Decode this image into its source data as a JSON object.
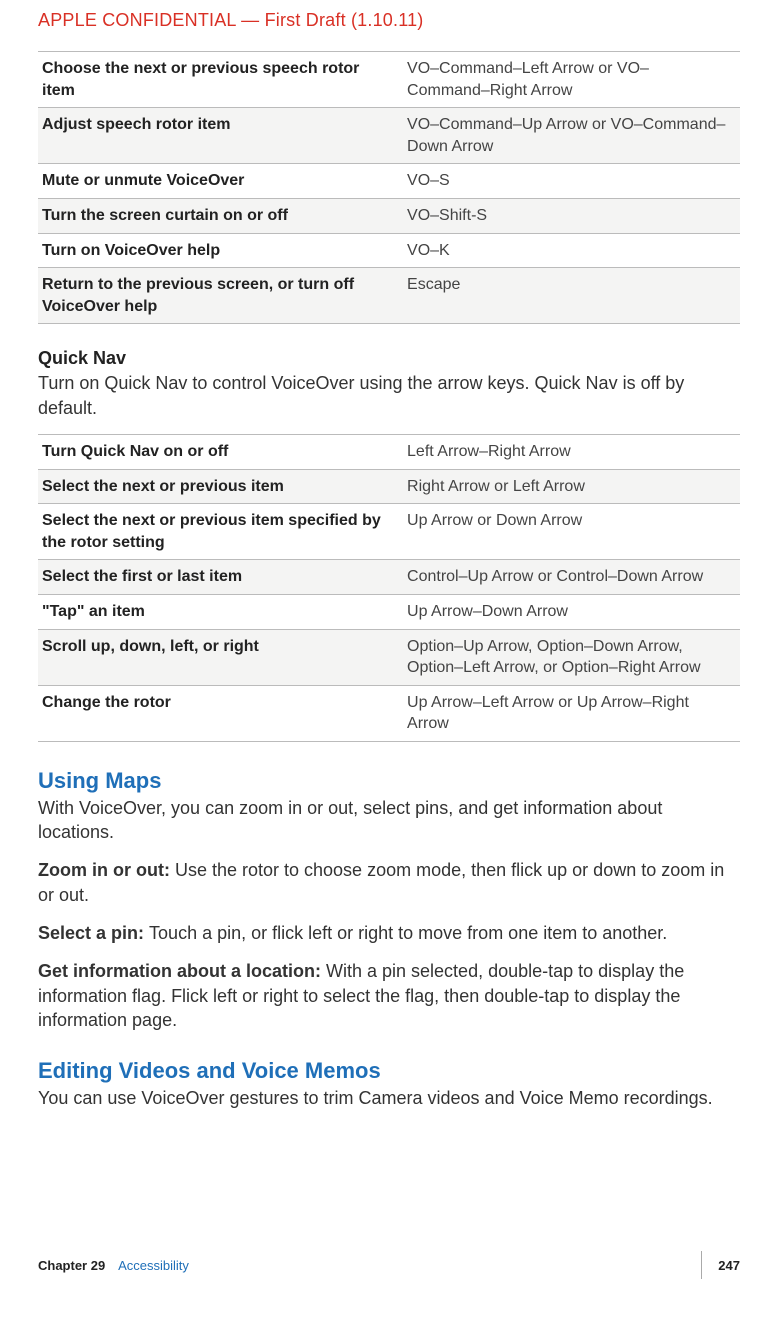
{
  "header": {
    "confidential": "APPLE CONFIDENTIAL  —  First Draft (1.10.11)"
  },
  "table1": {
    "rows": [
      {
        "label": "Choose the next or previous speech rotor item",
        "value": "VO–Command–Left Arrow or VO–Command–Right Arrow"
      },
      {
        "label": "Adjust speech rotor item",
        "value": "VO–Command–Up Arrow or VO–Command–Down Arrow"
      },
      {
        "label": "Mute or unmute VoiceOver",
        "value": "VO–S"
      },
      {
        "label": "Turn the screen curtain on or off",
        "value": "VO–Shift-S"
      },
      {
        "label": "Turn on VoiceOver help",
        "value": "VO–K"
      },
      {
        "label": "Return to the previous screen, or turn off VoiceOver help",
        "value": "Escape"
      }
    ]
  },
  "quicknav": {
    "heading": "Quick Nav",
    "body": "Turn on Quick Nav to control VoiceOver using the arrow keys. Quick Nav is off by default."
  },
  "table2": {
    "rows": [
      {
        "label": "Turn Quick Nav on or off",
        "value": "Left Arrow–Right Arrow"
      },
      {
        "label": "Select the next or previous item",
        "value": "Right Arrow or Left Arrow"
      },
      {
        "label": "Select the next or previous item specified by the rotor setting",
        "value": "Up Arrow or Down Arrow"
      },
      {
        "label": "Select the first or last item",
        "value": "Control–Up Arrow or Control–Down Arrow"
      },
      {
        "label": "\"Tap\" an item",
        "value": "Up Arrow–Down Arrow"
      },
      {
        "label": "Scroll up, down, left, or right",
        "value": "Option–Up Arrow, Option–Down Arrow, Option–Left Arrow, or Option–Right Arrow"
      },
      {
        "label": "Change the rotor",
        "value": "Up Arrow–Left Arrow or Up Arrow–Right Arrow"
      }
    ]
  },
  "maps": {
    "heading": "Using Maps",
    "body": "With VoiceOver, you can zoom in or out, select pins, and get information about locations.",
    "zoom_label": "Zoom in or out:  ",
    "zoom_text": "Use the rotor to choose zoom mode, then flick up or down to zoom in or out.",
    "pin_label": "Select a pin:  ",
    "pin_text": "Touch a pin, or flick left or right to move from one item to another.",
    "info_label": "Get information about a location:  ",
    "info_text": "With a pin selected, double-tap to display the information flag. Flick left or right to select the flag, then double-tap to display the information page."
  },
  "editing": {
    "heading": "Editing Videos and Voice Memos",
    "body": "You can use VoiceOver gestures to trim Camera videos and Voice Memo recordings."
  },
  "footer": {
    "chapter": "Chapter 29",
    "title": "Accessibility",
    "page": "247"
  }
}
